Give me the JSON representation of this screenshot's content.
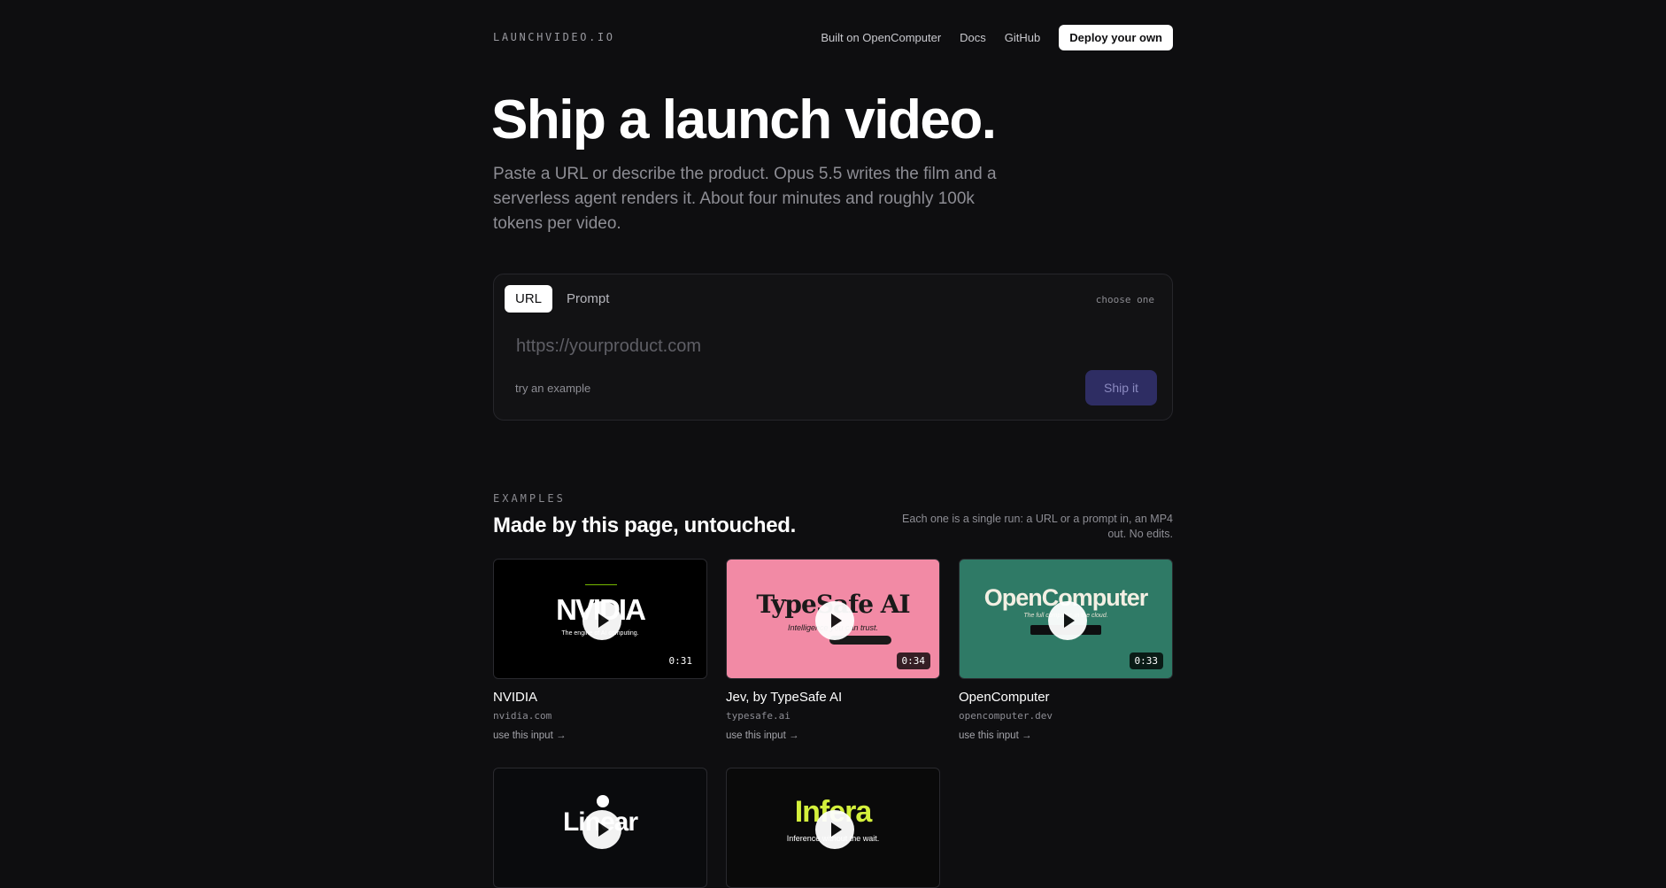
{
  "header": {
    "logo": "LAUNCHVIDEO.IO",
    "nav": [
      "Built on OpenComputer",
      "Docs",
      "GitHub"
    ],
    "deploy_label": "Deploy your own"
  },
  "hero": {
    "title": "Ship a launch video.",
    "subtitle": "Paste a URL or describe the product. Opus 5.5 writes the film and a serverless agent renders it. About four minutes and roughly 100k tokens per video."
  },
  "input_card": {
    "tabs": [
      "URL",
      "Prompt"
    ],
    "active_tab": "URL",
    "choose_label": "choose one",
    "placeholder": "https://yourproduct.com",
    "value": "",
    "try_example": "try an example",
    "submit_label": "Ship it"
  },
  "examples": {
    "label": "EXAMPLES",
    "title": "Made by this page, untouched.",
    "description": "Each one is a single run: a URL or a prompt in, an MP4 out. No edits.",
    "use_label": "use this input →",
    "cards": [
      {
        "name": "NVIDIA",
        "domain": "nvidia.com",
        "duration": "0:31",
        "thumb_text": "NVIDIA",
        "thumb_tagline": "The engine of AI computing.",
        "bg": "#000000",
        "fg": "#ffffff",
        "accent": "#76b900"
      },
      {
        "name": "Jev, by TypeSafe AI",
        "domain": "typesafe.ai",
        "duration": "0:34",
        "thumb_text": "TypeSafe AI",
        "thumb_tagline": "Intelligence you can trust.",
        "bg": "#f28aa5",
        "fg": "#1a1a1a",
        "accent": "#1a1a1a"
      },
      {
        "name": "OpenComputer",
        "domain": "opencomputer.dev",
        "duration": "0:33",
        "thumb_text": "OpenComputer",
        "thumb_tagline": "The full computer, in the cloud.",
        "bg": "#2f7a66",
        "fg": "#f3efe3",
        "accent": "#0e0e10"
      },
      {
        "name": "Linear",
        "domain": "",
        "duration": "",
        "thumb_text": "Linear",
        "thumb_tagline": "",
        "bg": "#0a0b0d",
        "fg": "#ffffff",
        "accent": "#6c6ff5"
      },
      {
        "name": "Infera",
        "domain": "",
        "duration": "",
        "thumb_text": "Infera",
        "thumb_tagline": "Inference without the wait.",
        "bg": "#0a0a0a",
        "fg": "#d4f03c",
        "accent": "#ffffff"
      }
    ]
  }
}
